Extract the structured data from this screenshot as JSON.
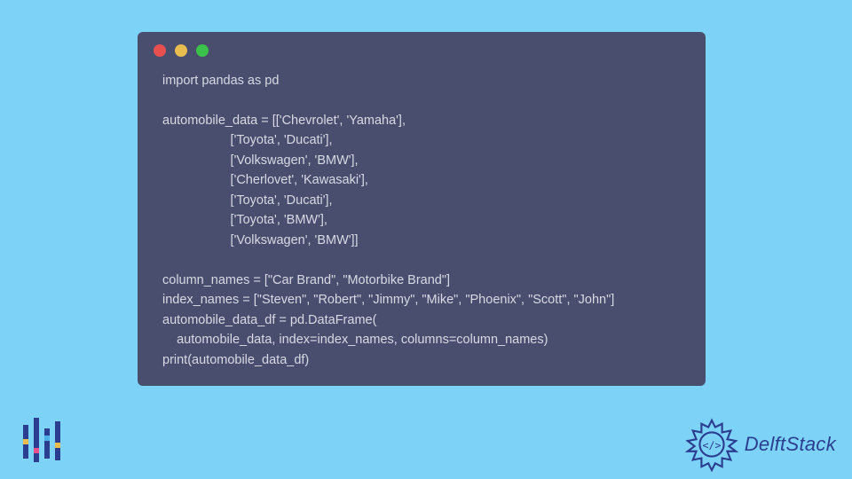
{
  "code": {
    "lines": [
      "import pandas as pd",
      "",
      "automobile_data = [['Chevrolet', 'Yamaha'],",
      "                   ['Toyota', 'Ducati'],",
      "                   ['Volkswagen', 'BMW'],",
      "                   ['Cherlovet', 'Kawasaki'],",
      "                   ['Toyota', 'Ducati'],",
      "                   ['Toyota', 'BMW'],",
      "                   ['Volkswagen', 'BMW']]",
      "",
      "column_names = [\"Car Brand\", \"Motorbike Brand\"]",
      "index_names = [\"Steven\", \"Robert\", \"Jimmy\", \"Mike\", \"Phoenix\", \"Scott\", \"John\"]",
      "automobile_data_df = pd.DataFrame(",
      "    automobile_data, index=index_names, columns=column_names)",
      "print(automobile_data_df)"
    ]
  },
  "branding": {
    "name": "DelftStack"
  }
}
